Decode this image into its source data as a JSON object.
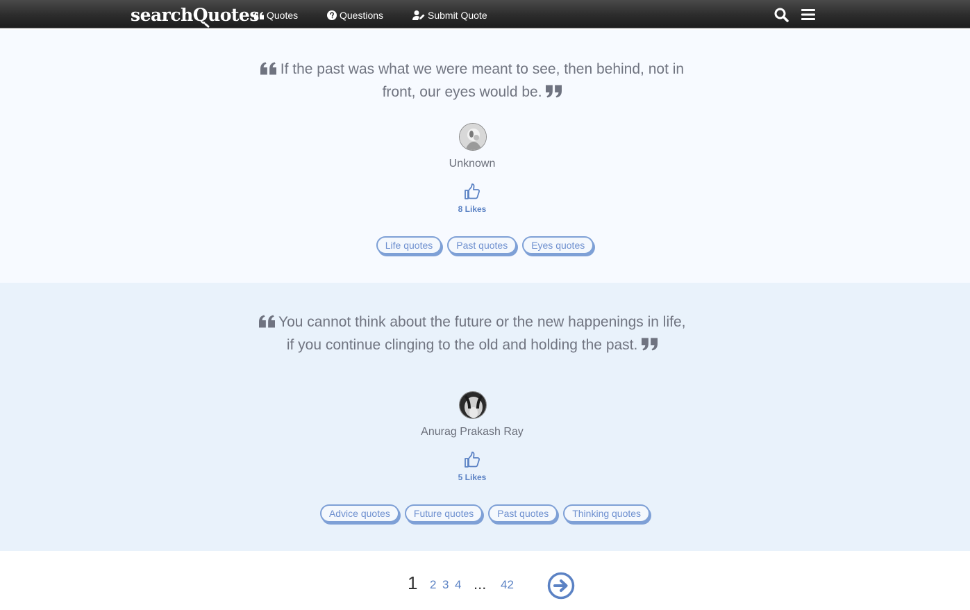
{
  "navbar": {
    "logo": {
      "part1": "search",
      "part2": "Q",
      "part3": "uotes"
    },
    "links": {
      "quotes": "Quotes",
      "questions": "Questions",
      "submit": "Submit Quote"
    },
    "icons": {
      "search": "search-icon",
      "menu": "hamburger-menu-icon"
    }
  },
  "quotes": [
    {
      "text": "If the past was what we were meant to see, then behind, not in front, our eyes would be.",
      "author": "Unknown",
      "likes": "8 Likes",
      "tags": [
        "Life quotes",
        "Past quotes",
        "Eyes quotes"
      ]
    },
    {
      "text": "You cannot think about the future or the new happenings in life, if you continue clinging to the old and holding the past.",
      "author": "Anurag Prakash Ray",
      "likes": "5 Likes",
      "tags": [
        "Advice quotes",
        "Future quotes",
        "Past quotes",
        "Thinking quotes"
      ]
    }
  ],
  "pagination": {
    "current": "1",
    "pages": [
      "2",
      "3",
      "4"
    ],
    "ellipsis": "...",
    "last": "42",
    "next_icon": "arrow-right-circle-icon"
  },
  "colors": {
    "navbar": "#2c2c2c",
    "accent": "#5b82c4",
    "tag_border": "#7ea0d6",
    "block1_bg": "#f7faff",
    "block2_bg": "#e9f2fb"
  }
}
